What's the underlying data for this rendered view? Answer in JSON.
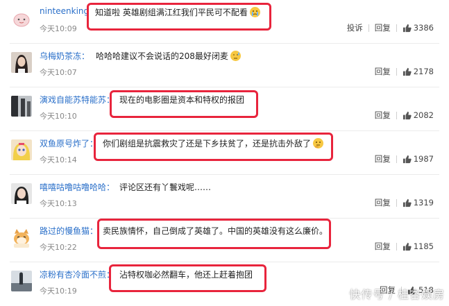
{
  "actions": {
    "report": "投诉",
    "reply": "回复"
  },
  "watermark": "快传号 / 桂杏娱房",
  "comments": [
    {
      "user": "ninteenking",
      "text": "知道啦 英雄剧组满江红我们平民可不配看",
      "emoji": "crying-face",
      "time": "今天10:09",
      "likes": "3386",
      "has_report": true
    },
    {
      "user": "乌梅奶茶冻：",
      "text": "哈哈哈建议不会说话的208最好闭麦",
      "emoji": "sweat-face",
      "time": "今天10:07",
      "likes": "2178",
      "has_report": false
    },
    {
      "user": "演戏自能苏特能苏：",
      "text": "现在的电影圈是资本和特权的报团",
      "emoji": "",
      "time": "今天10:10",
      "likes": "2082",
      "has_report": false
    },
    {
      "user": "双鱼原号炸了：",
      "text": "你们剧组是抗震救灾了还是下乡扶贫了，还是抗击外敌了",
      "emoji": "thinking-face",
      "time": "今天10:14",
      "likes": "1987",
      "has_report": false
    },
    {
      "user": "嘻嘻咕噜咕噜哈哈：",
      "text": "评论区还有丫鬟戏呢……",
      "emoji": "",
      "time": "今天10:13",
      "likes": "1319",
      "has_report": false
    },
    {
      "user": "路过的慢鱼猫：",
      "text": "卖民族情怀，自己倒成了英雄了。中国的英雄没有这么廉价。",
      "emoji": "",
      "time": "今天10:22",
      "likes": "1185",
      "has_report": false
    },
    {
      "user": "凉粉有杏冷面不煎：",
      "text": "沾特权咖必然翻车，他还上赶着抱团",
      "emoji": "",
      "time": "今天10:19",
      "likes": "518",
      "has_report": false
    }
  ],
  "colors": {
    "username": "#2a6fc9",
    "highlight": "#e8243c",
    "time": "#888888"
  }
}
